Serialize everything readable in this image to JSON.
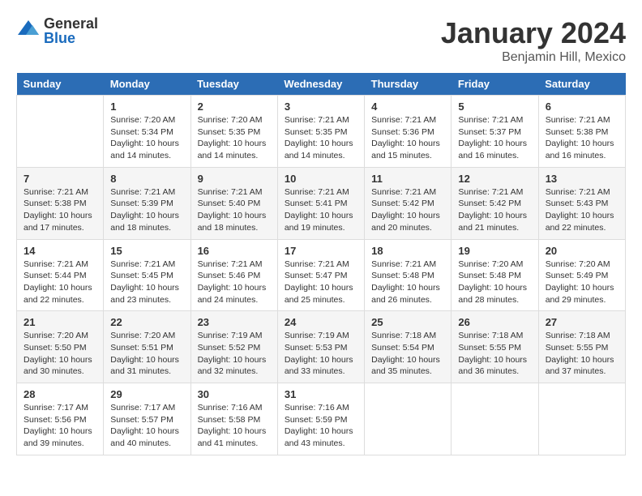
{
  "header": {
    "logo_general": "General",
    "logo_blue": "Blue",
    "month_title": "January 2024",
    "location": "Benjamin Hill, Mexico"
  },
  "calendar": {
    "days_of_week": [
      "Sunday",
      "Monday",
      "Tuesday",
      "Wednesday",
      "Thursday",
      "Friday",
      "Saturday"
    ],
    "weeks": [
      [
        {
          "day": "",
          "info": ""
        },
        {
          "day": "1",
          "info": "Sunrise: 7:20 AM\nSunset: 5:34 PM\nDaylight: 10 hours\nand 14 minutes."
        },
        {
          "day": "2",
          "info": "Sunrise: 7:20 AM\nSunset: 5:35 PM\nDaylight: 10 hours\nand 14 minutes."
        },
        {
          "day": "3",
          "info": "Sunrise: 7:21 AM\nSunset: 5:35 PM\nDaylight: 10 hours\nand 14 minutes."
        },
        {
          "day": "4",
          "info": "Sunrise: 7:21 AM\nSunset: 5:36 PM\nDaylight: 10 hours\nand 15 minutes."
        },
        {
          "day": "5",
          "info": "Sunrise: 7:21 AM\nSunset: 5:37 PM\nDaylight: 10 hours\nand 16 minutes."
        },
        {
          "day": "6",
          "info": "Sunrise: 7:21 AM\nSunset: 5:38 PM\nDaylight: 10 hours\nand 16 minutes."
        }
      ],
      [
        {
          "day": "7",
          "info": "Sunrise: 7:21 AM\nSunset: 5:38 PM\nDaylight: 10 hours\nand 17 minutes."
        },
        {
          "day": "8",
          "info": "Sunrise: 7:21 AM\nSunset: 5:39 PM\nDaylight: 10 hours\nand 18 minutes."
        },
        {
          "day": "9",
          "info": "Sunrise: 7:21 AM\nSunset: 5:40 PM\nDaylight: 10 hours\nand 18 minutes."
        },
        {
          "day": "10",
          "info": "Sunrise: 7:21 AM\nSunset: 5:41 PM\nDaylight: 10 hours\nand 19 minutes."
        },
        {
          "day": "11",
          "info": "Sunrise: 7:21 AM\nSunset: 5:42 PM\nDaylight: 10 hours\nand 20 minutes."
        },
        {
          "day": "12",
          "info": "Sunrise: 7:21 AM\nSunset: 5:42 PM\nDaylight: 10 hours\nand 21 minutes."
        },
        {
          "day": "13",
          "info": "Sunrise: 7:21 AM\nSunset: 5:43 PM\nDaylight: 10 hours\nand 22 minutes."
        }
      ],
      [
        {
          "day": "14",
          "info": "Sunrise: 7:21 AM\nSunset: 5:44 PM\nDaylight: 10 hours\nand 22 minutes."
        },
        {
          "day": "15",
          "info": "Sunrise: 7:21 AM\nSunset: 5:45 PM\nDaylight: 10 hours\nand 23 minutes."
        },
        {
          "day": "16",
          "info": "Sunrise: 7:21 AM\nSunset: 5:46 PM\nDaylight: 10 hours\nand 24 minutes."
        },
        {
          "day": "17",
          "info": "Sunrise: 7:21 AM\nSunset: 5:47 PM\nDaylight: 10 hours\nand 25 minutes."
        },
        {
          "day": "18",
          "info": "Sunrise: 7:21 AM\nSunset: 5:48 PM\nDaylight: 10 hours\nand 26 minutes."
        },
        {
          "day": "19",
          "info": "Sunrise: 7:20 AM\nSunset: 5:48 PM\nDaylight: 10 hours\nand 28 minutes."
        },
        {
          "day": "20",
          "info": "Sunrise: 7:20 AM\nSunset: 5:49 PM\nDaylight: 10 hours\nand 29 minutes."
        }
      ],
      [
        {
          "day": "21",
          "info": "Sunrise: 7:20 AM\nSunset: 5:50 PM\nDaylight: 10 hours\nand 30 minutes."
        },
        {
          "day": "22",
          "info": "Sunrise: 7:20 AM\nSunset: 5:51 PM\nDaylight: 10 hours\nand 31 minutes."
        },
        {
          "day": "23",
          "info": "Sunrise: 7:19 AM\nSunset: 5:52 PM\nDaylight: 10 hours\nand 32 minutes."
        },
        {
          "day": "24",
          "info": "Sunrise: 7:19 AM\nSunset: 5:53 PM\nDaylight: 10 hours\nand 33 minutes."
        },
        {
          "day": "25",
          "info": "Sunrise: 7:18 AM\nSunset: 5:54 PM\nDaylight: 10 hours\nand 35 minutes."
        },
        {
          "day": "26",
          "info": "Sunrise: 7:18 AM\nSunset: 5:55 PM\nDaylight: 10 hours\nand 36 minutes."
        },
        {
          "day": "27",
          "info": "Sunrise: 7:18 AM\nSunset: 5:55 PM\nDaylight: 10 hours\nand 37 minutes."
        }
      ],
      [
        {
          "day": "28",
          "info": "Sunrise: 7:17 AM\nSunset: 5:56 PM\nDaylight: 10 hours\nand 39 minutes."
        },
        {
          "day": "29",
          "info": "Sunrise: 7:17 AM\nSunset: 5:57 PM\nDaylight: 10 hours\nand 40 minutes."
        },
        {
          "day": "30",
          "info": "Sunrise: 7:16 AM\nSunset: 5:58 PM\nDaylight: 10 hours\nand 41 minutes."
        },
        {
          "day": "31",
          "info": "Sunrise: 7:16 AM\nSunset: 5:59 PM\nDaylight: 10 hours\nand 43 minutes."
        },
        {
          "day": "",
          "info": ""
        },
        {
          "day": "",
          "info": ""
        },
        {
          "day": "",
          "info": ""
        }
      ]
    ]
  }
}
